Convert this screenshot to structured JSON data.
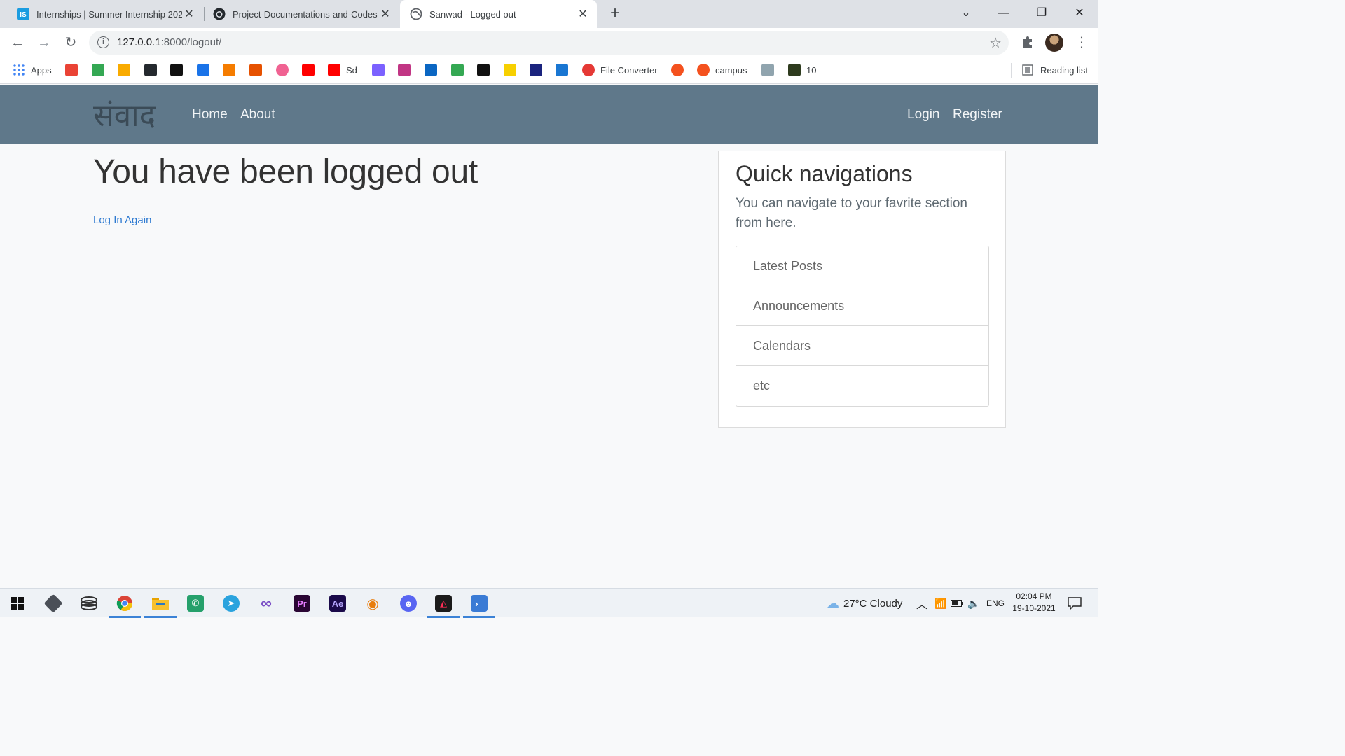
{
  "browser": {
    "tabs": [
      {
        "title": "Internships | Summer Internship 202",
        "active": false,
        "icon": "internshala-icon"
      },
      {
        "title": "Project-Documentations-and-Codes",
        "active": false,
        "icon": "github-icon"
      },
      {
        "title": "Sanwad - Logged out",
        "active": true,
        "icon": "globe-icon"
      }
    ],
    "url_host": "127.0.0.1",
    "url_path": ":8000/logout/",
    "bookmarks": [
      {
        "label": "Apps",
        "icon": "apps-grid-icon",
        "color": "#4285f4"
      },
      {
        "label": "",
        "icon": "gmail-icon",
        "color": "#ea4335"
      },
      {
        "label": "",
        "icon": "drive-icon",
        "color": "#34a853"
      },
      {
        "label": "",
        "icon": "classroom-icon",
        "color": "#f9ab00"
      },
      {
        "label": "",
        "icon": "github-icon",
        "color": "#24292e"
      },
      {
        "label": "",
        "icon": "hackerrank-icon",
        "color": "#111111"
      },
      {
        "label": "",
        "icon": "codechef-icon",
        "color": "#1a73e8"
      },
      {
        "label": "",
        "icon": "coursera-icon",
        "color": "#f57c00"
      },
      {
        "label": "",
        "icon": "matlab-icon",
        "color": "#e65100"
      },
      {
        "label": "",
        "icon": "power-icon",
        "color": "#f06292"
      },
      {
        "label": "",
        "icon": "youtube-icon",
        "color": "#ff0000"
      },
      {
        "label": "Sd",
        "icon": "youtube-icon",
        "color": "#ff0000"
      },
      {
        "label": "",
        "icon": "mega-icon",
        "color": "#7b61ff"
      },
      {
        "label": "",
        "icon": "instagram-icon",
        "color": "#c13584"
      },
      {
        "label": "",
        "icon": "linkedin-icon",
        "color": "#0a66c2"
      },
      {
        "label": "",
        "icon": "maps-icon",
        "color": "#34a853"
      },
      {
        "label": "",
        "icon": "amazon-icon",
        "color": "#111111"
      },
      {
        "label": "",
        "icon": "flipkart-icon",
        "color": "#f7d000"
      },
      {
        "label": "",
        "icon": "chart-icon",
        "color": "#1a237e"
      },
      {
        "label": "",
        "icon": "s-icon",
        "color": "#1976d2"
      },
      {
        "label": "File Converter",
        "icon": "heart-icon",
        "color": "#e53935"
      },
      {
        "label": "",
        "icon": "chat-icon",
        "color": "#f4511e"
      },
      {
        "label": "campus",
        "icon": "chat-icon",
        "color": "#f4511e"
      },
      {
        "label": "",
        "icon": "edge-icon",
        "color": "#90a4ae"
      },
      {
        "label": "10",
        "icon": "emblem-icon",
        "color": "#2e3b1e"
      }
    ],
    "reading_list": "Reading list"
  },
  "site": {
    "brand": "संवाद",
    "nav_left": [
      "Home",
      "About"
    ],
    "nav_right": [
      "Login",
      "Register"
    ],
    "colors": {
      "navbar": "#5f788a",
      "link": "#2e7ad1"
    }
  },
  "main": {
    "title": "You have been logged out",
    "relogin_link": "Log In Again"
  },
  "sidebar": {
    "title": "Quick navigations",
    "text": "You can navigate to your favrite section from here.",
    "items": [
      "Latest Posts",
      "Announcements",
      "Calendars",
      "etc"
    ]
  },
  "taskbar": {
    "weather": "27°C  Cloudy",
    "language": "ENG",
    "time": "02:04 PM",
    "date": "19-10-2021"
  }
}
